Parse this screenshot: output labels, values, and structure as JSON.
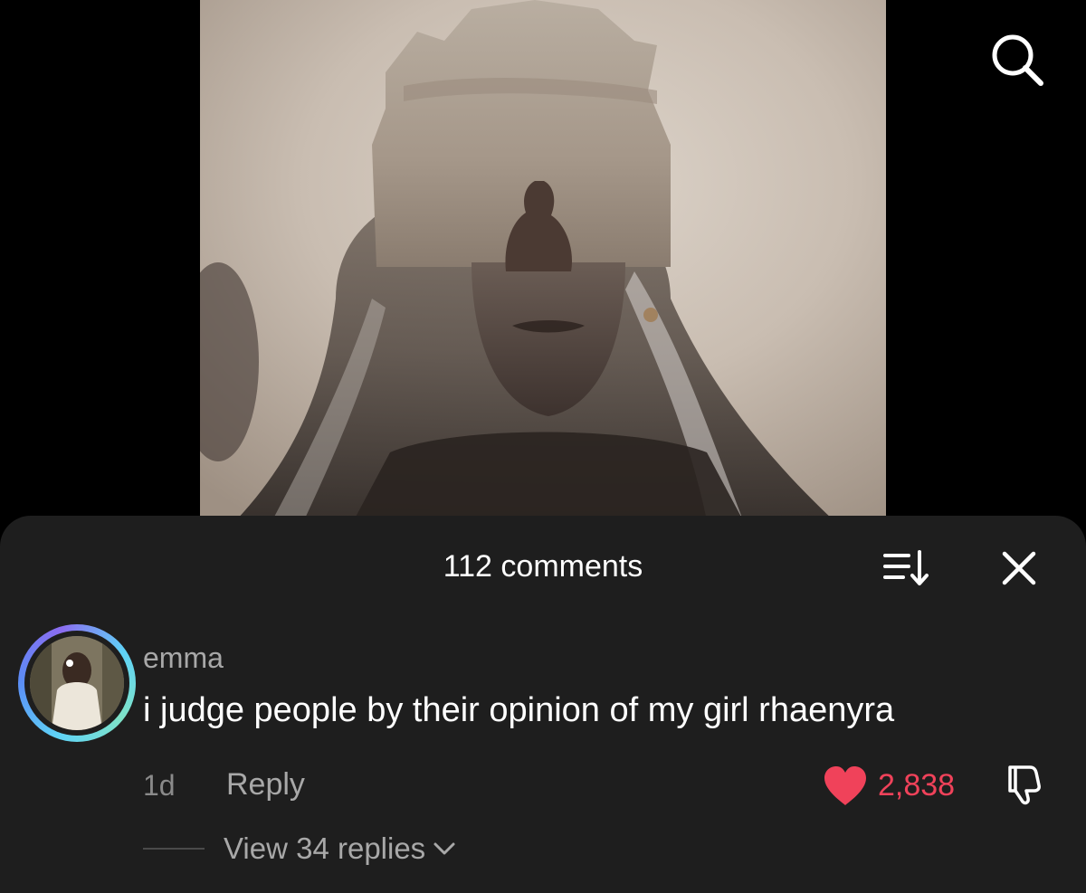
{
  "video": {
    "media_description": "video-frame",
    "search_icon": "search-icon"
  },
  "comments_sheet": {
    "title": "112 comments",
    "sort_icon": "sort-icon",
    "close_icon": "close-icon",
    "comment": {
      "username": "emma",
      "text": "i judge people by their opinion of my girl rhaenyra",
      "time": "1d",
      "reply_label": "Reply",
      "like_count": "2,838",
      "view_replies_label": "View 34 replies",
      "liked": true
    }
  },
  "colors": {
    "sheet_background": "#1e1e1e",
    "like_red": "#f0425a",
    "muted_text": "#a8a8a8"
  }
}
